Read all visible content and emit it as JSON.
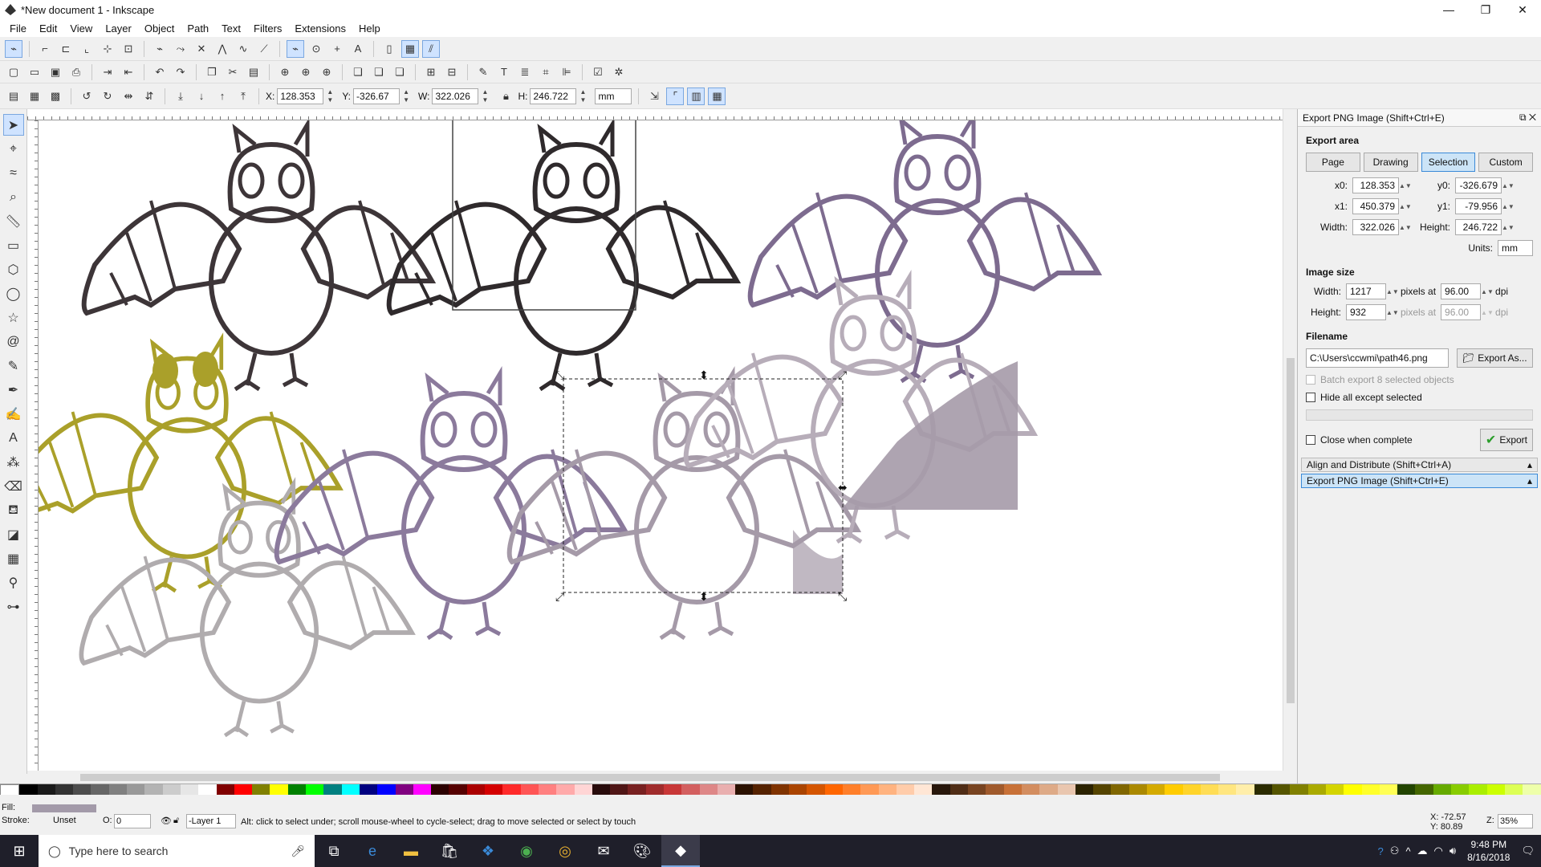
{
  "window": {
    "title": "*New document 1 - Inkscape",
    "buttons": [
      "—",
      "❐",
      "✕"
    ]
  },
  "menu": [
    "File",
    "Edit",
    "View",
    "Layer",
    "Object",
    "Path",
    "Text",
    "Filters",
    "Extensions",
    "Help"
  ],
  "tool_controls": {
    "x_label": "X:",
    "x_value": "128.353",
    "y_label": "Y:",
    "y_value": "-326.67",
    "w_label": "W:",
    "w_value": "322.026",
    "h_label": "H:",
    "h_value": "246.722",
    "unit": "mm"
  },
  "export_panel": {
    "title": "Export PNG Image (Shift+Ctrl+E)",
    "export_area": "Export area",
    "area_buttons": [
      "Page",
      "Drawing",
      "Selection",
      "Custom"
    ],
    "selected_area": "Selection",
    "x0_label": "x0:",
    "x0": "128.353",
    "y0_label": "y0:",
    "y0": "-326.679",
    "x1_label": "x1:",
    "x1": "450.379",
    "y1_label": "y1:",
    "y1": "-79.956",
    "width_label": "Width:",
    "width": "322.026",
    "height_label": "Height:",
    "height": "246.722",
    "units_label": "Units:",
    "units": "mm",
    "image_size": "Image size",
    "img_width_label": "Width:",
    "img_width": "1217",
    "img_height_label": "Height:",
    "img_height": "932",
    "pixels_at": "pixels at",
    "dpi_x": "96.00",
    "dpi_y": "96.00",
    "dpi": "dpi",
    "filename_label": "Filename",
    "filename": "C:\\Users\\ccwmi\\path46.png",
    "export_as": "Export As...",
    "batch": "Batch export 8 selected objects",
    "hide_all": "Hide all except selected",
    "close_when": "Close when complete",
    "export_btn": "Export"
  },
  "dock": {
    "align": "Align and Distribute (Shift+Ctrl+A)",
    "export": "Export PNG Image (Shift+Ctrl+E)"
  },
  "status": {
    "fill_label": "Fill:",
    "stroke_label": "Stroke:",
    "stroke_value": "Unset",
    "opacity_label": "O:",
    "opacity": "0",
    "layer": "-Layer 1",
    "message": "Alt: click to select under; scroll mouse-wheel to cycle-select; drag to move selected or select by touch",
    "x_coord": "X: -72.57",
    "y_coord": "Y: 80.89",
    "zoom_label": "Z:",
    "zoom": "35%"
  },
  "taskbar": {
    "search_placeholder": "Type here to search",
    "time": "9:48 PM",
    "date": "8/16/2018"
  },
  "colors": {
    "bat_dark": "#3d3538",
    "bat_mustard": "#aaa02a",
    "bat_purple": "#7d6b8f",
    "bat_grey": "#a59aa8",
    "selection_accent": "#3a8ad8"
  }
}
